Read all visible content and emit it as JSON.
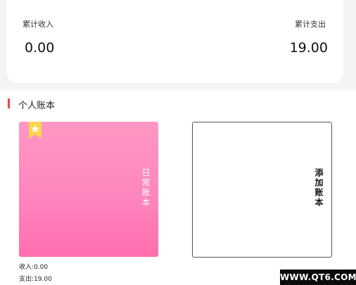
{
  "summary": {
    "income_label": "累计收入",
    "income_value": "0.00",
    "expense_label": "累计支出",
    "expense_value": "19.00"
  },
  "section": {
    "title": "个人账本",
    "accent_color": "#e04b4b"
  },
  "books": [
    {
      "title": "日常账本",
      "income": "收入:0.00",
      "expense": "支出:19.00",
      "gradient_colors": [
        "#ff97c4",
        "#ff6eaf"
      ],
      "badge_icon": "star-bookmark-icon"
    }
  ],
  "add_book": {
    "label": "添加账本"
  },
  "watermark": "WWW.QT6.COM"
}
